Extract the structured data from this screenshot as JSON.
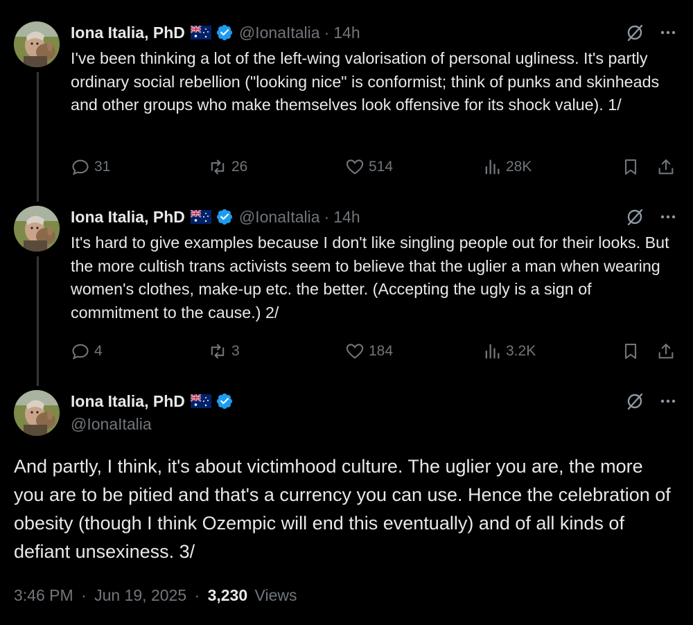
{
  "tweets": [
    {
      "name": "Iona Italia, PhD",
      "handle": "@IonaItalia",
      "time": "14h",
      "text": "I've been thinking a lot of the left-wing valorisation of personal ugliness. It's partly ordinary social rebellion (\"looking nice\" is conformist; think of punks and skinheads and other groups who make themselves look offensive for its shock value). 1/",
      "replies": "31",
      "reposts": "26",
      "likes": "514",
      "views": "28K"
    },
    {
      "name": "Iona Italia, PhD",
      "handle": "@IonaItalia",
      "time": "14h",
      "text": "It's hard to give examples because I don't like singling people out for their looks. But the more cultish trans activists seem to believe that the uglier a man when wearing women's clothes, make-up etc. the better. (Accepting the ugly is a sign of commitment to the cause.) 2/",
      "replies": "4",
      "reposts": "3",
      "likes": "184",
      "views": "3.2K"
    }
  ],
  "main_tweet": {
    "name": "Iona Italia, PhD",
    "handle": "@IonaItalia",
    "text": "And partly, I think, it's about victimhood culture. The uglier you are, the more you are to be pitied and that's a currency you can use. Hence the celebration of obesity (though I think Ozempic will end this eventually) and of all kinds of defiant unsexiness. 3/",
    "time": "3:46 PM",
    "date": "Jun 19, 2025",
    "views_count": "3,230",
    "views_label": "Views"
  },
  "separators": {
    "dot": "·"
  },
  "colors": {
    "background": "#000000",
    "text": "#e7e9ea",
    "muted": "#71767b",
    "verified": "#1d9bf0",
    "thread_line": "#333639"
  },
  "icons": [
    "australia-flag-icon",
    "verified-badge-icon",
    "grok-icon",
    "more-icon",
    "reply-icon",
    "repost-icon",
    "like-icon",
    "views-icon",
    "bookmark-icon",
    "share-icon"
  ]
}
